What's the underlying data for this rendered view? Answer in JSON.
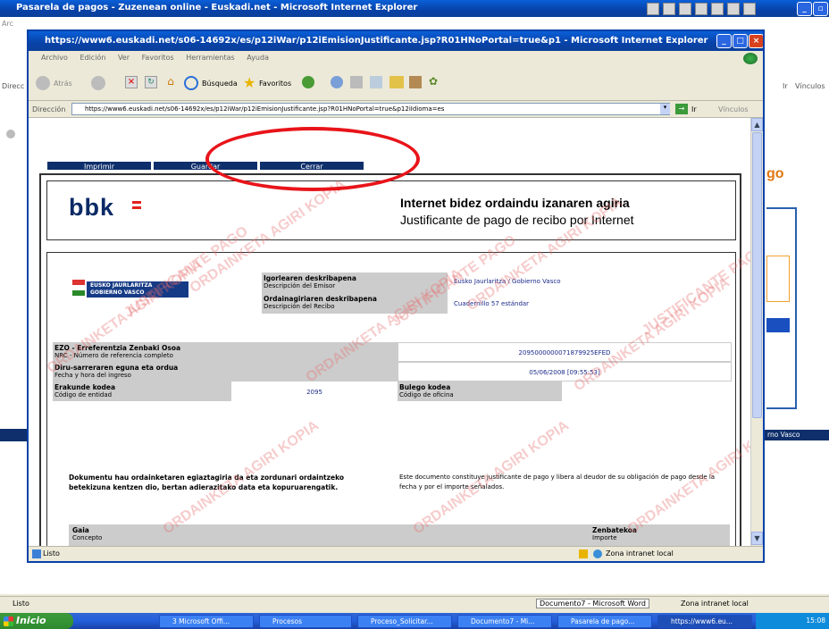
{
  "outer_window": {
    "title": "Pasarela de pagos - Zuzenean online - Euskadi.net - Microsoft Internet Explorer",
    "left_labels": [
      "Arc",
      "Direcc"
    ],
    "right_label": "Vínculos",
    "ir": "Ir",
    "logo_fragment": "go",
    "right_fragment": "rno Vasco",
    "status_text": "Listo",
    "status_zone": "Zona intranet local",
    "status_doc": "Documento7 - Microsoft Word"
  },
  "inner_window": {
    "title": "https://www6.euskadi.net/s06-14692x/es/p12iWar/p12iEmisionJustificante.jsp?R01HNoPortal=true&p1 - Microsoft Internet Explorer",
    "menu": [
      "Archivo",
      "Edición",
      "Ver",
      "Favoritos",
      "Herramientas",
      "Ayuda"
    ],
    "toolbar": {
      "back": "Atrás",
      "search": "Búsqueda",
      "favorites": "Favoritos"
    },
    "address_label": "Dirección",
    "address_value": "https://www6.euskadi.net/s06-14692x/es/p12iWar/p12iEmisionJustificante.jsp?R01HNoPortal=true&p12iIdioma=es",
    "go_label": "Ir",
    "links_label": "Vínculos",
    "status_text": "Listo",
    "status_zone": "Zona intranet local"
  },
  "nav": {
    "print": "Imprimir",
    "save": "Guardar",
    "close": "Cerrar"
  },
  "receipt": {
    "bank_logo": "bbk",
    "title_eu": "Internet bidez ordaindu izanaren agiria",
    "title_es": "Justificante de pago de recibo por Internet",
    "gov_logo_line1": "EUSKO JAURLARITZA",
    "gov_logo_line2": "GOBIERNO VASCO",
    "issuer_label_eu": "Igorlearen deskribapena",
    "issuer_label_es": "Descripción del Emisor",
    "issuer_value": "Eusko Jaurlaritza / Gobierno Vasco",
    "receipt_label_eu": "Ordainagiriaren deskribapena",
    "receipt_label_es": "Descripción del Recibo",
    "receipt_value": "Cuadernillo 57 estándar",
    "nrc_label_eu": "EZO - Erreferentzia Zenbaki Osoa",
    "nrc_label_es": "NRC - Número de referencia completo",
    "nrc_value": "2095000000071879925EFED",
    "date_label_eu": "Diru-sarreraren eguna eta ordua",
    "date_label_es": "Fecha y hora del ingreso",
    "date_value": "05/06/2008 [09:55:53]",
    "entity_label_eu": "Erakunde kodea",
    "entity_label_es": "Código de entidad",
    "entity_value": "2095",
    "office_label_eu": "Bulego kodea",
    "office_label_es": "Código de oficina",
    "office_value": "",
    "note_eu": "Dokumentu hau ordainketaren egiaztagiria da eta zordunari ordaintzeko betekizuna kentzen dio, bertan adierazitako data eta kopuruarengatik.",
    "note_es": "Este documento constituye justificante de pago y libera al deudor de su obligación de pago desde la fecha y por el importe señalados.",
    "concept_label_eu": "Gaia",
    "concept_label_es": "Concepto",
    "amount_label_eu": "Zenbatekoa",
    "amount_label_es": "Importe",
    "watermark_a": "ORDAINKETA AGIRI KOPIA",
    "watermark_b": "JUSTIFICANTE PAGO"
  },
  "taskbar": {
    "start": "Inicio",
    "tasks": [
      "3 Microsoft Offi...",
      "Procesos",
      "Proceso_Solicitar...",
      "Documento7 - Mi...",
      "Pasarela de pago...",
      "https://www6.eu..."
    ],
    "clock": "15:08"
  },
  "colors": {
    "nav_bg": "#0e2f6b",
    "value_text": "#1a2a8a",
    "highlight_circle": "#e8141a",
    "bbk_accent": "#e2231a"
  }
}
